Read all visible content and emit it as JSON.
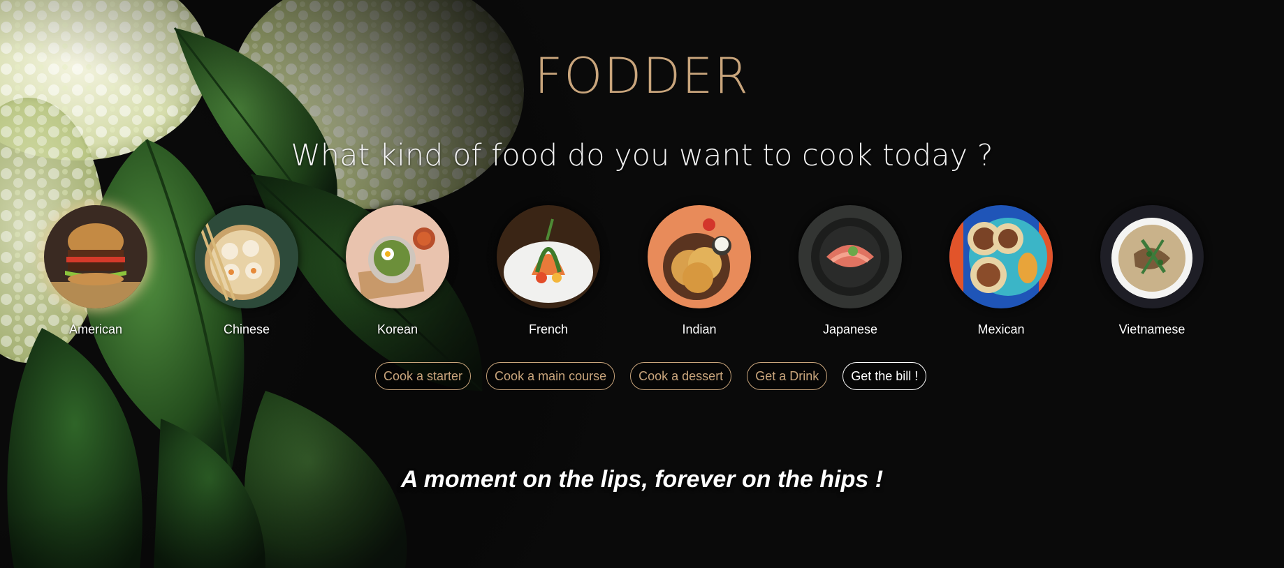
{
  "app": {
    "title": "FODDER",
    "subtitle": "What kind of food do you want to cook today ?",
    "tagline": "A moment on the lips, forever on the hips !"
  },
  "cuisines": [
    {
      "label": "American",
      "selected": true
    },
    {
      "label": "Chinese",
      "selected": false
    },
    {
      "label": "Korean",
      "selected": false
    },
    {
      "label": "French",
      "selected": false
    },
    {
      "label": "Indian",
      "selected": false
    },
    {
      "label": "Japanese",
      "selected": false
    },
    {
      "label": "Mexican",
      "selected": false
    },
    {
      "label": "Vietnamese",
      "selected": false
    }
  ],
  "actions": [
    {
      "label": "Cook a starter"
    },
    {
      "label": "Cook a main course"
    },
    {
      "label": "Cook a dessert"
    },
    {
      "label": "Get a Drink"
    },
    {
      "label": "Get the bill !"
    }
  ],
  "colors": {
    "background": "#0a0a0a",
    "accent_gold": "#c9a57c",
    "text_white": "#ffffff"
  }
}
